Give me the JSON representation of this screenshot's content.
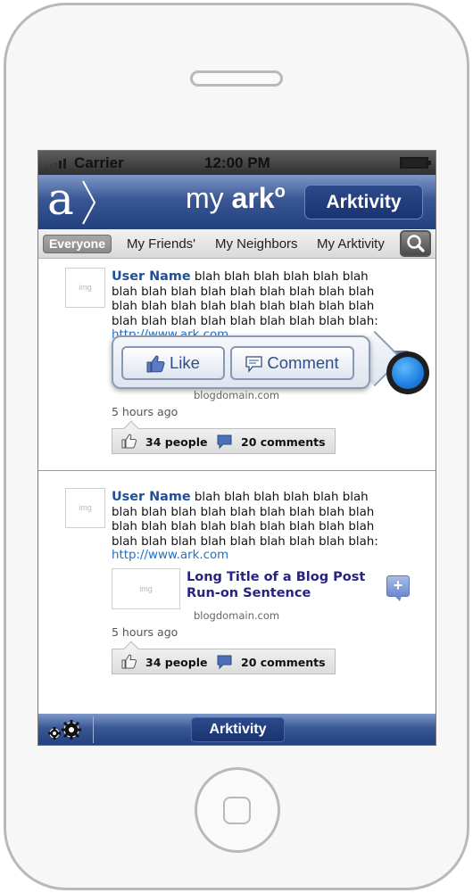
{
  "status": {
    "carrier": "Carrier",
    "time": "12:00 PM"
  },
  "header": {
    "brand_my": "my",
    "brand_ark": "ark",
    "brand_mark": "o",
    "button": "Arktivity",
    "logo_letter": "a"
  },
  "filters": {
    "active": "Everyone",
    "tabs": [
      "My Friends'",
      "My Neighbors",
      "My Arktivity"
    ]
  },
  "posts": [
    {
      "avatar": "img",
      "user": "User Name",
      "text": " blah blah blah blah blah blah blah blah blah blah blah blah blah blah blah blah blah blah blah blah blah blah blah blah blah blah blah blah blah blah blah blah blah:",
      "link": "http://www.ark.com",
      "domain": "blogdomain.com",
      "time": "5 hours ago",
      "likes": "34 people",
      "comments": "20 comments"
    },
    {
      "avatar": "img",
      "user": "User Name",
      "text": " blah blah blah blah blah blah blah blah blah blah blah blah blah blah blah blah blah blah blah blah blah blah blah blah blah blah blah blah blah blah blah blah blah:",
      "link": "http://www.ark.com",
      "thumb": "img",
      "title": "Long Title of a Blog Post Run-on Sentence",
      "domain": "blogdomain.com",
      "time": "5 hours ago",
      "likes": "34 people",
      "comments": "20 comments"
    }
  ],
  "popup": {
    "like": "Like",
    "comment": "Comment"
  },
  "tabbar": {
    "button": "Arktivity"
  },
  "icons": [
    "gear-icon",
    "search-icon",
    "thumbs-up-icon",
    "comment-icon",
    "add-comment-icon"
  ],
  "colors": {
    "nav_blue": "#3a5795",
    "user_blue": "#1f4f97",
    "title_navy": "#27237e",
    "link_blue": "#1f6fcc"
  }
}
